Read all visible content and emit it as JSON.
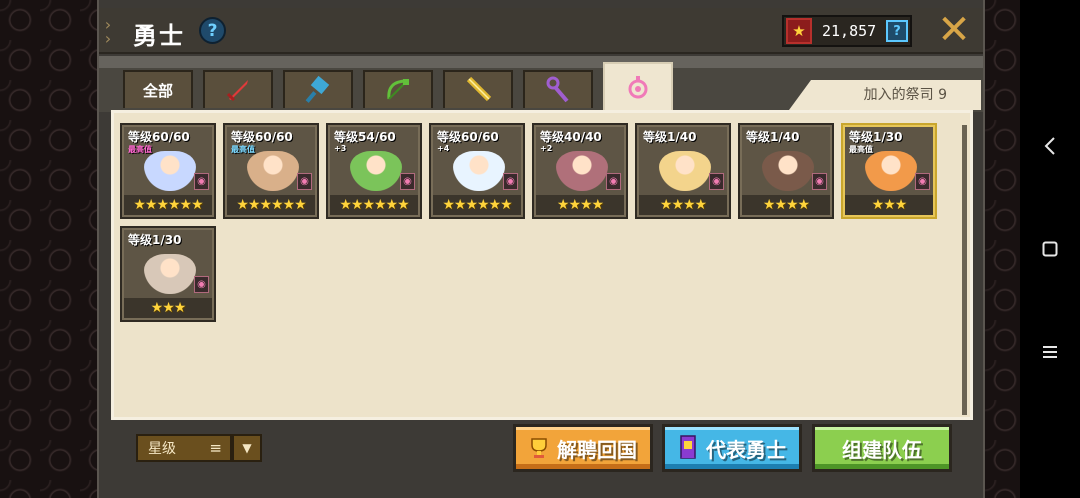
{
  "header": {
    "title": "勇士",
    "help_symbol": "?",
    "currency_value": "21,857",
    "currency_help_symbol": "?",
    "close_symbol": "✕"
  },
  "tabs": [
    {
      "label": "全部",
      "icon": "all-text"
    },
    {
      "label": "",
      "icon": "sword-icon",
      "color": "#e03a3a"
    },
    {
      "label": "",
      "icon": "hammer-icon",
      "color": "#3ea8d6"
    },
    {
      "label": "",
      "icon": "bow-icon",
      "color": "#62c13a"
    },
    {
      "label": "",
      "icon": "gun-icon",
      "color": "#e0b830"
    },
    {
      "label": "",
      "icon": "staff-icon",
      "color": "#a05ed0"
    },
    {
      "label": "",
      "icon": "priest-icon",
      "color": "#f07ab8",
      "active": true
    }
  ],
  "priest_count_text": "加入的祭司 9",
  "heroes": [
    {
      "level": "等级60/60",
      "tag": "最高值",
      "tag_color": "#ff66d0",
      "stars": "★★★★★★",
      "art": "#c8d8ff",
      "gold": false
    },
    {
      "level": "等级60/60",
      "tag": "最高值",
      "tag_color": "#7ad8ff",
      "stars": "★★★★★★",
      "art": "#d9b08a",
      "gold": false
    },
    {
      "level": "等级54/60",
      "tag": "+3",
      "tag_color": "#ffffff",
      "stars": "★★★★★★",
      "art": "#7bc45a",
      "gold": false
    },
    {
      "level": "等级60/60",
      "tag": "+4",
      "tag_color": "#ffffff",
      "stars": "★★★★★★",
      "art": "#e8f4ff",
      "gold": false
    },
    {
      "level": "等级40/40",
      "tag": "+2",
      "tag_color": "#ffffff",
      "stars": "★★★★",
      "art": "#b0707a",
      "gold": false
    },
    {
      "level": "等级1/40",
      "tag": "",
      "tag_color": "#ffffff",
      "stars": "★★★★",
      "art": "#f3d48c",
      "gold": false
    },
    {
      "level": "等级1/40",
      "tag": "",
      "tag_color": "#ffffff",
      "stars": "★★★★",
      "art": "#7a5a4a",
      "gold": false
    },
    {
      "level": "等级1/30",
      "tag": "最高值",
      "tag_color": "#ffffff",
      "stars": "★★★",
      "art": "#f29a4a",
      "gold": true
    },
    {
      "level": "等级1/30",
      "tag": "",
      "tag_color": "#ffffff",
      "stars": "★★★",
      "art": "#d8c8b8",
      "gold": false
    }
  ],
  "footer": {
    "sort_label": "星级",
    "sort_icon": "≡",
    "dropdown_icon": "▼",
    "dismiss_label": "解聘回国",
    "representative_label": "代表勇士",
    "team_label": "组建队伍"
  },
  "nav": {
    "back": "‹",
    "home": "□",
    "menu": "≡"
  },
  "colors": {
    "panel_bg": "#3d3a36",
    "content_bg": "#ede3ca",
    "dismiss_btn": "#f2a43a",
    "representative_btn": "#45b7e6",
    "team_btn": "#8ccf4f",
    "star": "#ffd43c"
  }
}
